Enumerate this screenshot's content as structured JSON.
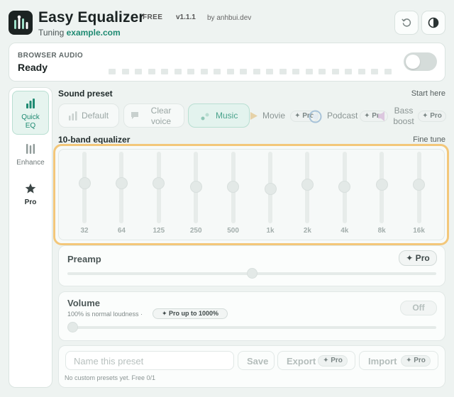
{
  "header": {
    "app_title": "Easy Equalizer",
    "plan": "FREE",
    "version": "v1.1.1",
    "author": "by anhbui.dev",
    "tuning_label": "Tuning",
    "tuning_site": "example.com"
  },
  "audio": {
    "label": "BROWSER AUDIO",
    "status": "Ready",
    "enabled": false
  },
  "sidebar": {
    "items": [
      {
        "label_line1": "Quick",
        "label_line2": "EQ",
        "icon": "bars-chart-icon",
        "active": true
      },
      {
        "label": "Enhance",
        "icon": "sliders-icon",
        "active": false
      },
      {
        "label": "Pro",
        "icon": "star-icon",
        "active": false
      }
    ]
  },
  "presets": {
    "title": "Sound preset",
    "hint": "Start here",
    "items": [
      {
        "label": "Default",
        "icon": "bars-chart-icon"
      },
      {
        "label_line1": "Clear",
        "label_line2": "voice",
        "icon": "speech-icon"
      },
      {
        "label": "Music",
        "icon": "music-note-icon",
        "active": true
      },
      {
        "label": "Movie",
        "icon": "play-icon",
        "pro": "✦ Pro"
      },
      {
        "label": "Podcast",
        "icon": "mic-circle-icon",
        "pro": "✦ Pro"
      },
      {
        "label_line1": "Bass",
        "label_line2": "boost",
        "icon": "speaker-icon",
        "pro": "✦ Pro"
      }
    ]
  },
  "equalizer": {
    "title": "10-band equalizer",
    "hint": "Fine tune",
    "bands": [
      {
        "freq": "32",
        "level": 0.44
      },
      {
        "freq": "64",
        "level": 0.44
      },
      {
        "freq": "125",
        "level": 0.44
      },
      {
        "freq": "250",
        "level": 0.49
      },
      {
        "freq": "500",
        "level": 0.49
      },
      {
        "freq": "1k",
        "level": 0.52
      },
      {
        "freq": "2k",
        "level": 0.46
      },
      {
        "freq": "4k",
        "level": 0.49
      },
      {
        "freq": "8k",
        "level": 0.46
      },
      {
        "freq": "16k",
        "level": 0.46
      }
    ]
  },
  "preamp": {
    "title": "Preamp",
    "badge": "✦ Pro",
    "level": 0.5
  },
  "volume": {
    "title": "Volume",
    "subtitle": "100% is normal loudness ·",
    "pro_pill": "✦ Pro up to 1000%",
    "toggle_label": "Off",
    "level": 0.0
  },
  "footer": {
    "name_placeholder": "Name this preset",
    "save": "Save",
    "export": "Export",
    "import": "Import",
    "pro_tag": "✦ Pro",
    "status": "No custom presets yet. Free 0/1"
  },
  "colors": {
    "accent": "#1e8a72",
    "highlight_border": "#f3c77a"
  }
}
